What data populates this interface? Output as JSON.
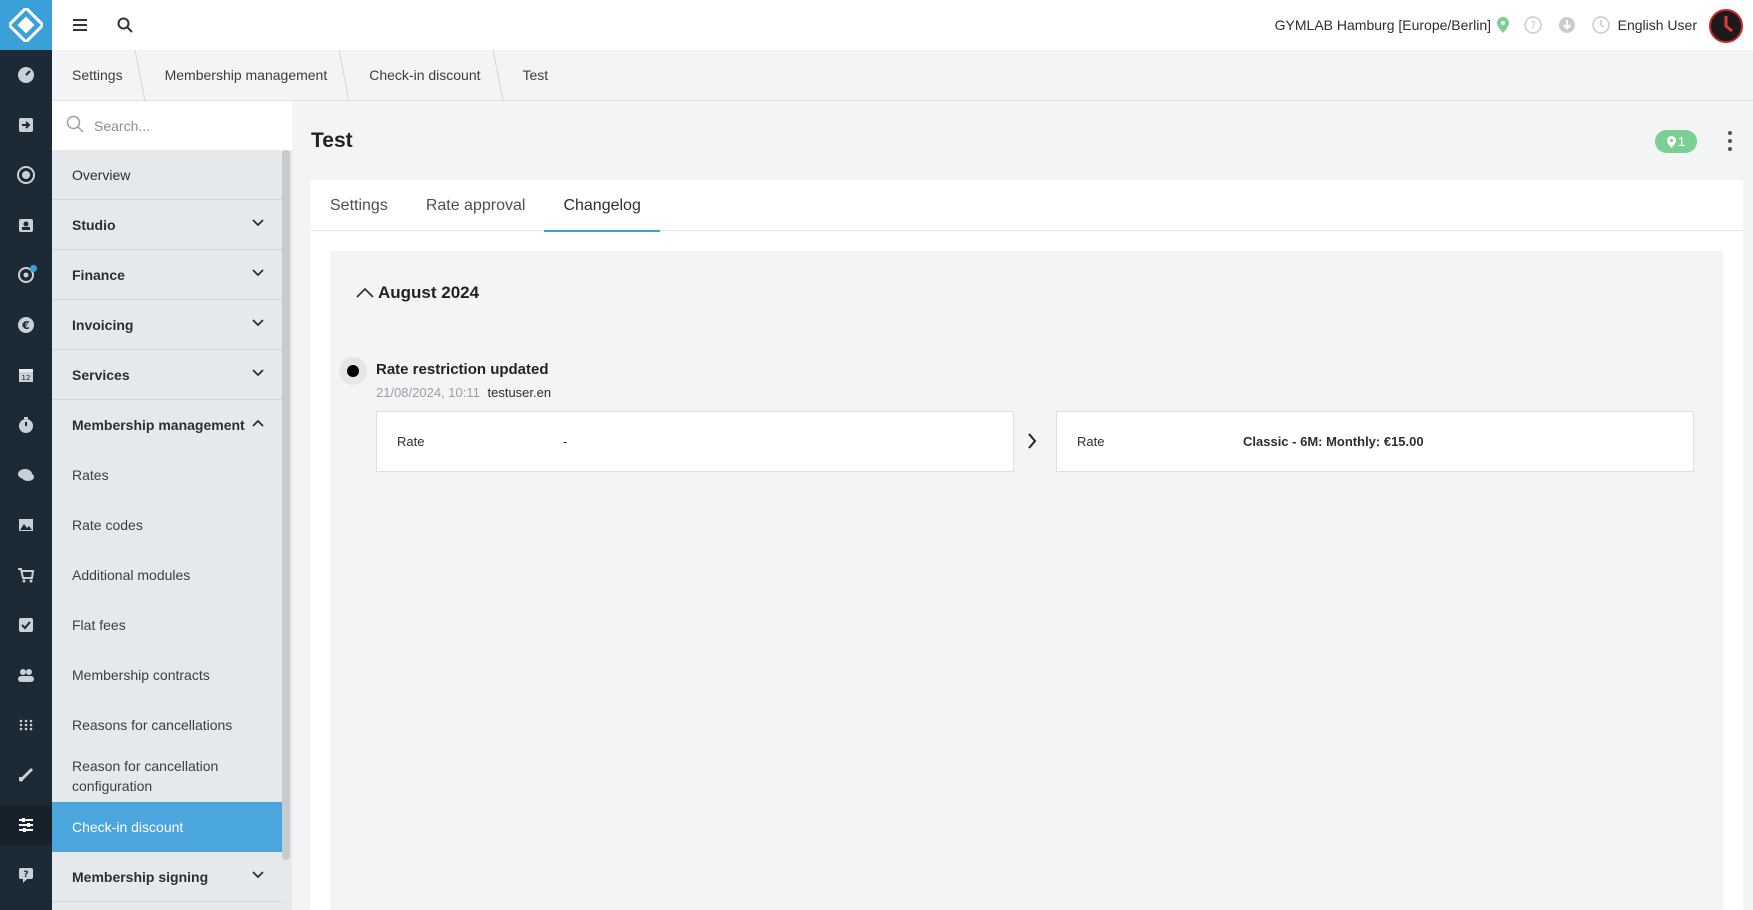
{
  "topbar": {
    "studio": "GYMLAB Hamburg [Europe/Berlin]",
    "user": "English User"
  },
  "breadcrumb": [
    "Settings",
    "Membership management",
    "Check-in discount",
    "Test"
  ],
  "sidebar": {
    "search_placeholder": "Search...",
    "items": [
      {
        "label": "Overview",
        "kind": "link"
      },
      {
        "label": "Studio",
        "kind": "group"
      },
      {
        "label": "Finance",
        "kind": "group"
      },
      {
        "label": "Invoicing",
        "kind": "group"
      },
      {
        "label": "Services",
        "kind": "group"
      },
      {
        "label": "Membership management",
        "kind": "group-open"
      }
    ],
    "sub_items": [
      "Rates",
      "Rate codes",
      "Additional modules",
      "Flat fees",
      "Membership contracts",
      "Reasons for cancellations",
      "Reason for cancellation configuration",
      "Check-in discount"
    ],
    "after": {
      "label": "Membership signing"
    }
  },
  "page": {
    "title": "Test",
    "badge_count": "1",
    "tabs": [
      "Settings",
      "Rate approval",
      "Changelog"
    ],
    "active_tab": "Changelog"
  },
  "changelog": {
    "month": "August 2024",
    "entry": {
      "title": "Rate restriction updated",
      "date": "21/08/2024, 10:11",
      "user": "testuser.en",
      "old": {
        "key": "Rate",
        "value": "-"
      },
      "new": {
        "key": "Rate",
        "value": "Classic - 6M: Monthly: €15.00"
      }
    }
  },
  "colors": {
    "accent": "#3aa0d8",
    "rail": "#1c2a35",
    "badge": "#7ccf92"
  }
}
